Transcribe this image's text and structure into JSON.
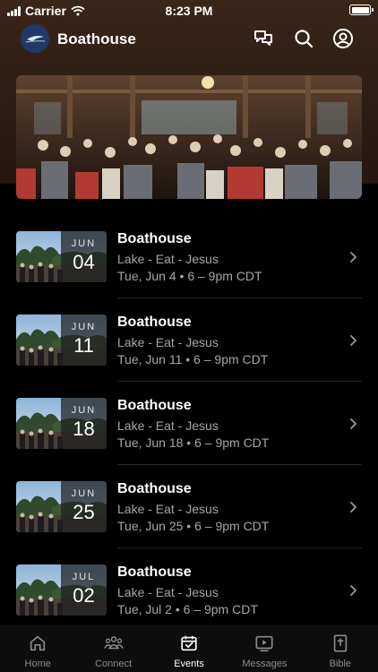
{
  "status_bar": {
    "carrier": "Carrier",
    "time": "8:23 PM"
  },
  "header": {
    "title": "Boathouse",
    "icons": [
      "chat-icon",
      "search-icon",
      "profile-icon"
    ]
  },
  "events": [
    {
      "title": "Boathouse",
      "subtitle": "Lake - Eat - Jesus",
      "when": "Tue, Jun 4 • 6 – 9pm CDT",
      "month": "JUN",
      "day": "04"
    },
    {
      "title": "Boathouse",
      "subtitle": "Lake - Eat - Jesus",
      "when": "Tue, Jun 11 • 6 – 9pm CDT",
      "month": "JUN",
      "day": "11"
    },
    {
      "title": "Boathouse",
      "subtitle": "Lake - Eat - Jesus",
      "when": "Tue, Jun 18 • 6 – 9pm CDT",
      "month": "JUN",
      "day": "18"
    },
    {
      "title": "Boathouse",
      "subtitle": "Lake - Eat - Jesus",
      "when": "Tue, Jun 25 • 6 – 9pm CDT",
      "month": "JUN",
      "day": "25"
    },
    {
      "title": "Boathouse",
      "subtitle": "Lake - Eat - Jesus",
      "when": "Tue, Jul 2 • 6 – 9pm CDT",
      "month": "JUL",
      "day": "02"
    }
  ],
  "tabs": [
    {
      "label": "Home",
      "icon": "home-icon",
      "active": false
    },
    {
      "label": "Connect",
      "icon": "people-icon",
      "active": false
    },
    {
      "label": "Events",
      "icon": "calendar-check-icon",
      "active": true
    },
    {
      "label": "Messages",
      "icon": "play-icon",
      "active": false
    },
    {
      "label": "Bible",
      "icon": "bible-icon",
      "active": false
    }
  ],
  "colors": {
    "header_bg": "#2c1c12",
    "background": "#000000",
    "muted_text": "#a6a6a6",
    "tab_inactive": "#8c8c8c"
  }
}
